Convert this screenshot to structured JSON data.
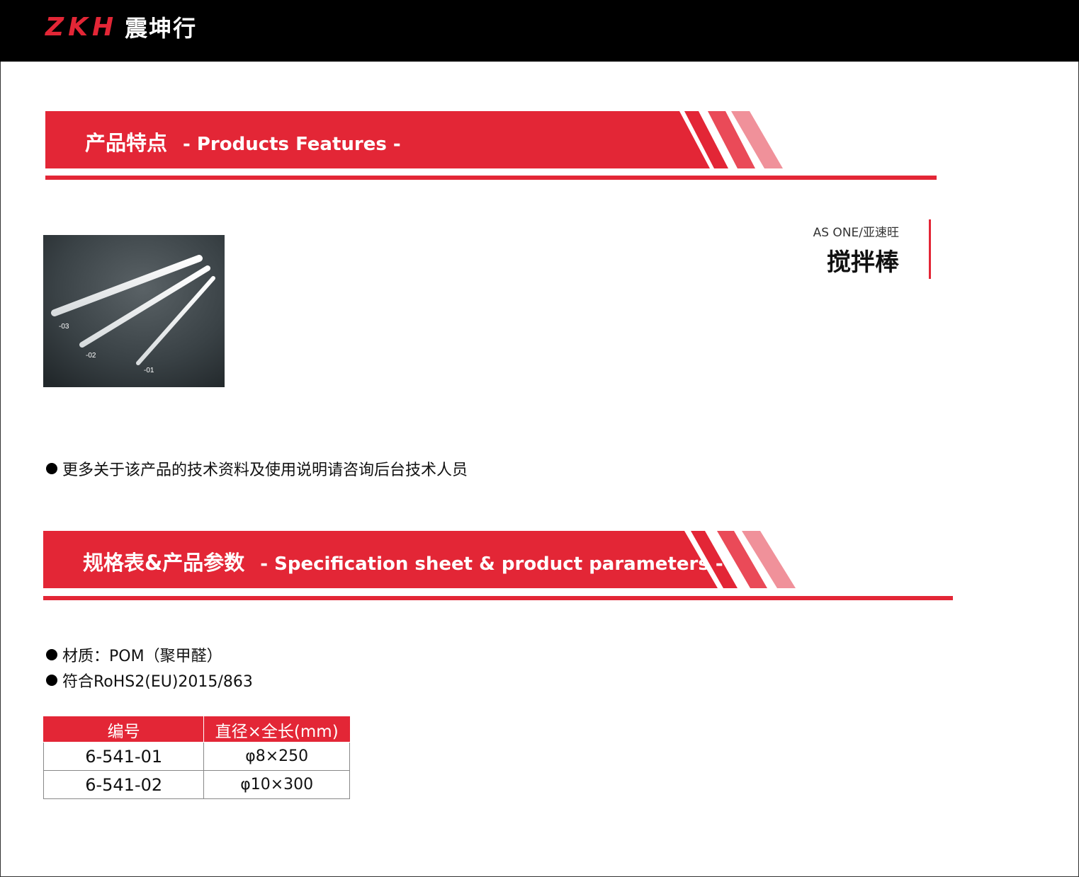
{
  "header": {
    "logo_latin": "ZKH",
    "logo_cn": "震坤行"
  },
  "section_features": {
    "title_cn": "产品特点",
    "title_en": "- Products Features -"
  },
  "product": {
    "image_labels": [
      "-03",
      "-02",
      "-01"
    ],
    "brand": "AS ONE/亚速旺",
    "name": "搅拌棒",
    "note": "更多关于该产品的技术资料及使用说明请咨询后台技术人员"
  },
  "section_spec": {
    "title_cn": "规格表&产品参数",
    "title_en": "-  Specification sheet & product parameters  -"
  },
  "spec_bullets": [
    "材质：POM（聚甲醛）",
    "符合RoHS2(EU)2015/863"
  ],
  "spec_table": {
    "headers": [
      "编号",
      "直径×全长(mm)"
    ],
    "rows": [
      [
        "6-541-01",
        "φ8×250"
      ],
      [
        "6-541-02",
        "φ10×300"
      ]
    ]
  },
  "colors": {
    "brand_red": "#e32636",
    "light_red": "#f0919a",
    "topbar": "#000000"
  }
}
